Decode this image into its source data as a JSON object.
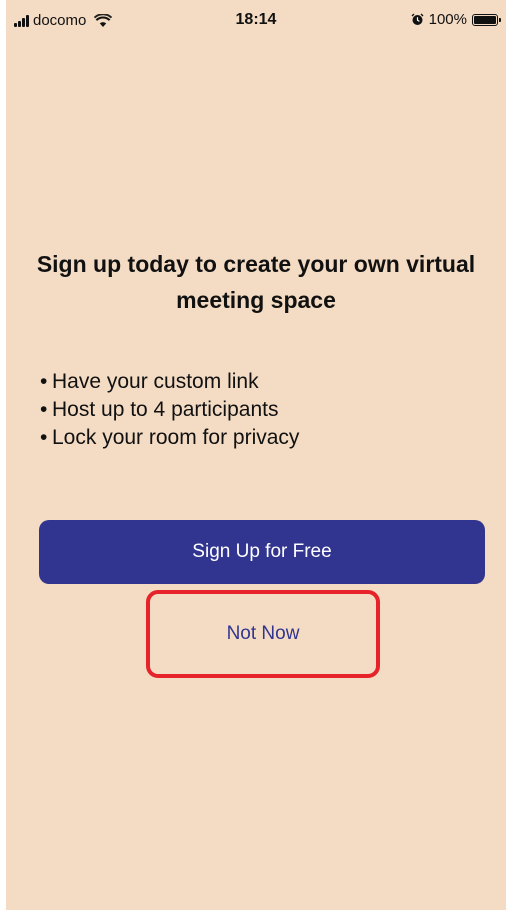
{
  "status_bar": {
    "carrier": "docomo",
    "time": "18:14",
    "battery_percent": "100%",
    "battery_level": 1.0,
    "icons": [
      "signal-icon",
      "wifi-icon",
      "alarm-icon",
      "battery-icon"
    ]
  },
  "main": {
    "headline": "Sign up today to create your own virtual meeting space",
    "features": [
      "Have your custom link",
      "Host up to 4 participants",
      "Lock your room for privacy"
    ],
    "signup_label": "Sign Up for Free",
    "not_now_label": "Not Now"
  },
  "colors": {
    "background": "#f4dcc4",
    "primary": "#323590",
    "highlight": "#e6232b"
  }
}
